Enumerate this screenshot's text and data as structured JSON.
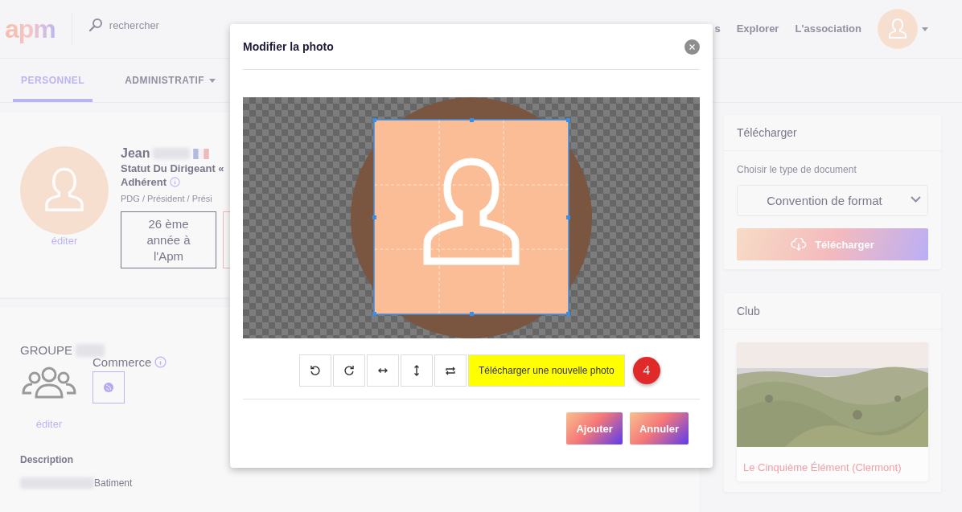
{
  "header": {
    "logo": "apm",
    "search": {
      "placeholder": "rechercher"
    },
    "nav": [
      {
        "label": "s"
      },
      {
        "label": "Explorer"
      },
      {
        "label": "L'association"
      }
    ]
  },
  "tabs": [
    {
      "label": "PERSONNEL",
      "selected": true,
      "has_menu": false
    },
    {
      "label": "ADMINISTRATIF",
      "selected": false,
      "has_menu": true
    }
  ],
  "profile": {
    "first_name": "Jean",
    "status": "Statut Du Dirigeant «",
    "membership": "Adhérent",
    "roles": "PDG / Président / Prési",
    "edit_link": "éditer",
    "seniority": "26 ème année à l'Apm"
  },
  "group": {
    "title": "GROUPE",
    "sector": "Commerce",
    "edit_link": "éditer",
    "description_label": "Description",
    "description": "Batiment"
  },
  "download": {
    "title": "Télécharger",
    "label": "Choisir le type de document",
    "selected_type": "Convention de format",
    "button": "Télécharger"
  },
  "club": {
    "title": "Club",
    "name": "Le Cinquième Élément (Clermont)"
  },
  "modal": {
    "title": "Modifier la photo",
    "tools": [
      {
        "kind": "rotate-left"
      },
      {
        "kind": "rotate-right"
      },
      {
        "kind": "flip-horizontal"
      },
      {
        "kind": "flip-vertical"
      },
      {
        "kind": "swap"
      }
    ],
    "upload_button": "Télécharger une nouvelle photo",
    "step_marker": "4",
    "actions": [
      "Ajouter",
      "Annuler"
    ]
  }
}
